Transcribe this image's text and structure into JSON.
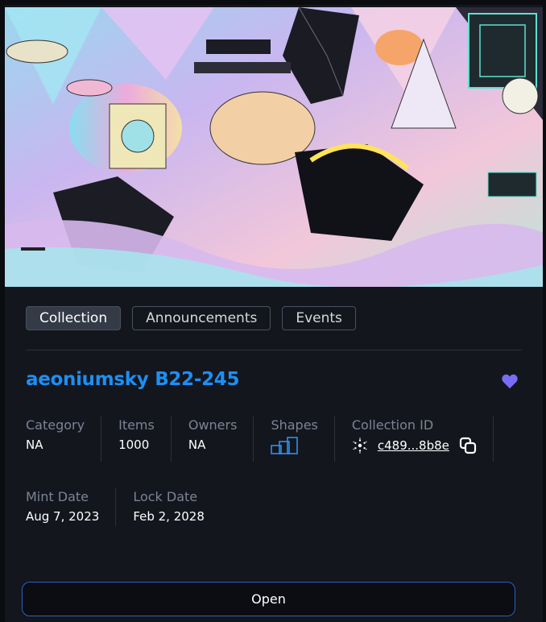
{
  "tabs": [
    {
      "label": "Collection",
      "active": true
    },
    {
      "label": "Announcements",
      "active": false
    },
    {
      "label": "Events",
      "active": false
    }
  ],
  "collection": {
    "title": "aeoniumsky B22-245",
    "favorite_icon": "heart-icon",
    "stats": {
      "category": {
        "label": "Category",
        "value": "NA"
      },
      "items": {
        "label": "Items",
        "value": "1000"
      },
      "owners": {
        "label": "Owners",
        "value": "NA"
      },
      "shapes": {
        "label": "Shapes",
        "icon": "shapes-icon"
      },
      "collection_id": {
        "label": "Collection ID",
        "value": "c489...8b8e",
        "icon": "cardano-icon",
        "copy_icon": "copy-icon"
      }
    },
    "dates": {
      "mint": {
        "label": "Mint Date",
        "value": "Aug 7, 2023"
      },
      "lock": {
        "label": "Lock Date",
        "value": "Feb 2, 2028"
      }
    }
  },
  "actions": {
    "open_label": "Open"
  },
  "colors": {
    "accent": "#1d8ff5",
    "heart": "#7b6cf6",
    "button_border": "#2d5fc4"
  }
}
